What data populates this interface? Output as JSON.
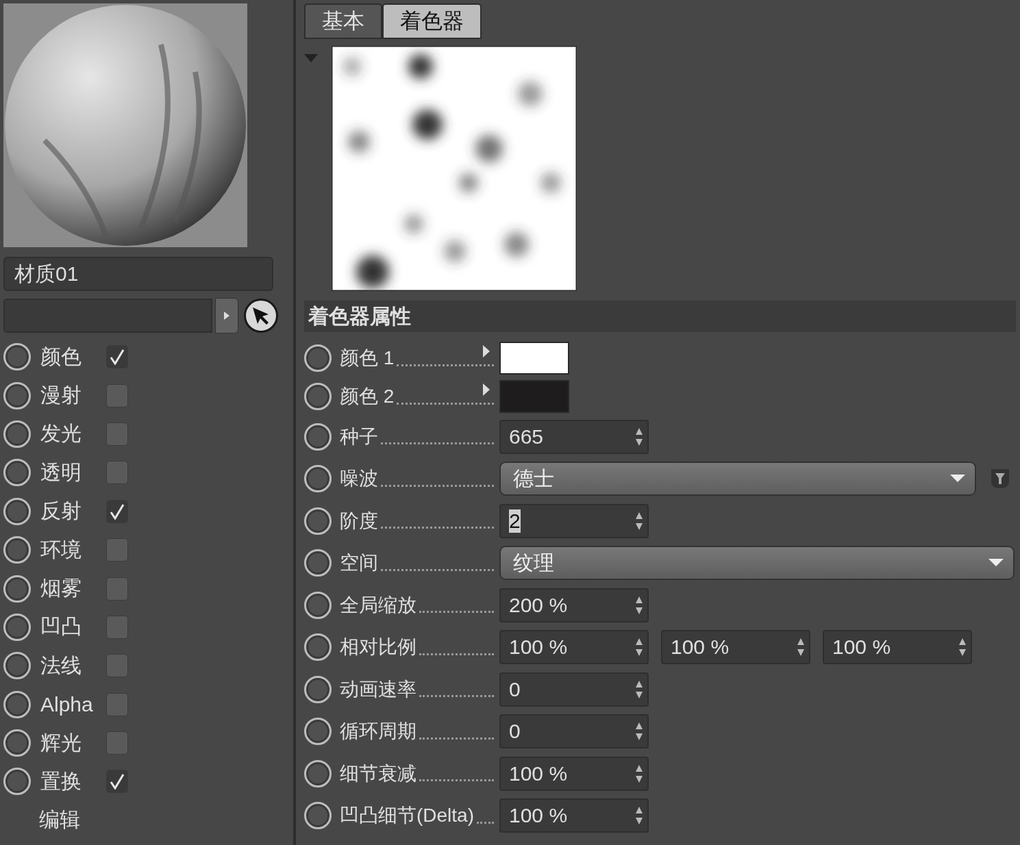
{
  "material_name": "材质01",
  "channels": [
    {
      "label": "颜色",
      "checked": true,
      "kind": "channel"
    },
    {
      "label": "漫射",
      "checked": false,
      "kind": "channel"
    },
    {
      "label": "发光",
      "checked": false,
      "kind": "channel"
    },
    {
      "label": "透明",
      "checked": false,
      "kind": "channel"
    },
    {
      "label": "反射",
      "checked": true,
      "kind": "channel"
    },
    {
      "label": "环境",
      "checked": false,
      "kind": "channel"
    },
    {
      "label": "烟雾",
      "checked": false,
      "kind": "channel"
    },
    {
      "label": "凹凸",
      "checked": false,
      "kind": "channel"
    },
    {
      "label": "法线",
      "checked": false,
      "kind": "channel"
    },
    {
      "label": "Alpha",
      "checked": false,
      "kind": "channel"
    },
    {
      "label": "辉光",
      "checked": false,
      "kind": "channel"
    },
    {
      "label": "置换",
      "checked": true,
      "kind": "channel"
    },
    {
      "label": "编辑",
      "kind": "label"
    }
  ],
  "tabs": [
    {
      "label": "基本",
      "selected": false
    },
    {
      "label": "着色器",
      "selected": true
    }
  ],
  "section_title": "着色器属性",
  "properties": [
    {
      "kind": "color",
      "label": "颜色 1",
      "color": "#ffffff"
    },
    {
      "kind": "color",
      "label": "颜色 2",
      "color": "#1e1c1c"
    },
    {
      "kind": "number",
      "label": "种子",
      "values": [
        "665"
      ]
    },
    {
      "kind": "select",
      "label": "噪波",
      "value": "德士",
      "filter": true
    },
    {
      "kind": "number",
      "label": "阶度",
      "values": [
        "2"
      ],
      "highlighted": true
    },
    {
      "kind": "select",
      "label": "空间",
      "value": "纹理",
      "filter": false
    },
    {
      "kind": "number",
      "label": "全局缩放",
      "values": [
        "200 %"
      ]
    },
    {
      "kind": "number",
      "label": "相对比例",
      "values": [
        "100 %",
        "100 %",
        "100 %"
      ]
    },
    {
      "kind": "number",
      "label": "动画速率",
      "values": [
        "0"
      ]
    },
    {
      "kind": "number",
      "label": "循环周期",
      "values": [
        "0"
      ]
    },
    {
      "kind": "number",
      "label": "细节衰减",
      "values": [
        "100 %"
      ]
    },
    {
      "kind": "number",
      "label": "凹凸细节(Delta)",
      "values": [
        "100 %"
      ]
    }
  ]
}
